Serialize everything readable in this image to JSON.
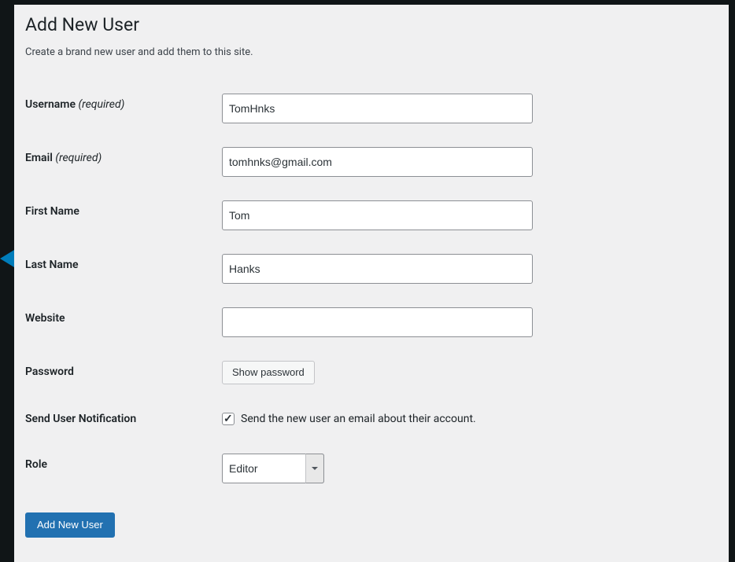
{
  "page": {
    "title": "Add New User",
    "description": "Create a brand new user and add them to this site."
  },
  "form": {
    "username": {
      "label": "Username",
      "required_text": "(required)",
      "value": "TomHnks"
    },
    "email": {
      "label": "Email",
      "required_text": "(required)",
      "value": "tomhnks@gmail.com"
    },
    "first_name": {
      "label": "First Name",
      "value": "Tom"
    },
    "last_name": {
      "label": "Last Name",
      "value": "Hanks"
    },
    "website": {
      "label": "Website",
      "value": ""
    },
    "password": {
      "label": "Password",
      "button_label": "Show password"
    },
    "notification": {
      "label": "Send User Notification",
      "checkbox_label": "Send the new user an email about their account.",
      "checked": true
    },
    "role": {
      "label": "Role",
      "selected": "Editor"
    }
  },
  "submit": {
    "label": "Add New User"
  }
}
